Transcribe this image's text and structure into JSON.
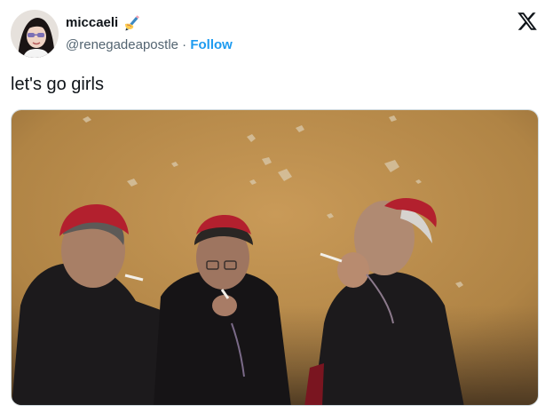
{
  "author": {
    "display_name": "miccaeli",
    "handle": "@renegadeapostle",
    "separator": "·",
    "follow_label": "Follow",
    "name_emoji": "writing-hand-icon"
  },
  "tweet": {
    "text": "let's go girls"
  },
  "colors": {
    "follow": "#1d9bf0",
    "handle": "#536471",
    "wall": "#b88a4a",
    "zucchetto": "#b3202e",
    "cassock": "#1c1a1c"
  },
  "media": {
    "kind": "photo"
  }
}
